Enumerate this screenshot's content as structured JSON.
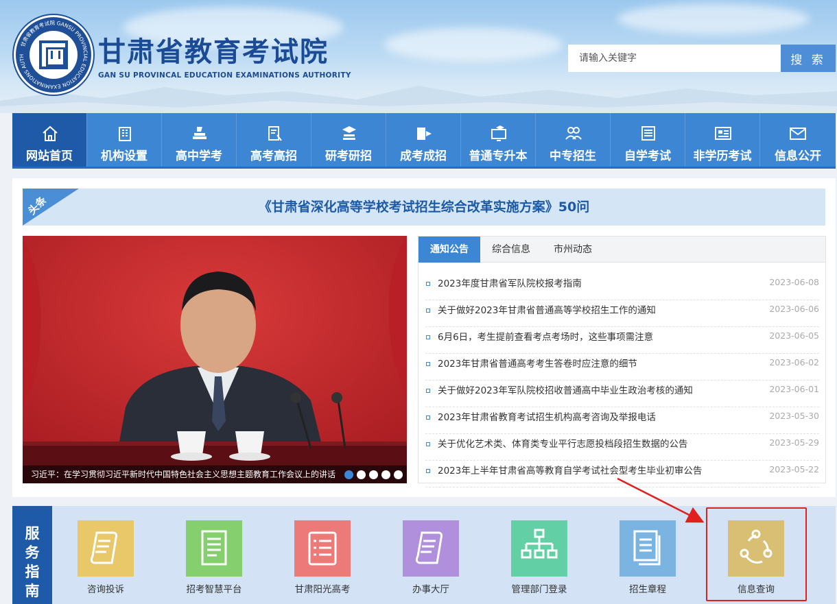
{
  "header": {
    "title": "甘肃省教育考试院",
    "subtitle": "GAN SU PROVINCAL EDUCATION EXAMINATIONS AUTHORITY",
    "seal_text": "甘肃省教育考试院 GANSU PROVINCIAL EDUCATION EXAMINATIONS AUTHORITY",
    "search_placeholder": "请输入关键字",
    "search_button": "搜 索"
  },
  "nav": [
    {
      "label": "网站首页",
      "icon": "home-icon",
      "active": true
    },
    {
      "label": "机构设置",
      "icon": "building-icon"
    },
    {
      "label": "高中学考",
      "icon": "books-icon"
    },
    {
      "label": "高考高招",
      "icon": "document-pen-icon"
    },
    {
      "label": "研考研招",
      "icon": "graduation-books-icon"
    },
    {
      "label": "成考成招",
      "icon": "book-flag-icon"
    },
    {
      "label": "普通专升本",
      "icon": "monitor-cap-icon"
    },
    {
      "label": "中专招生",
      "icon": "people-icon"
    },
    {
      "label": "自学考试",
      "icon": "list-icon"
    },
    {
      "label": "非学历考试",
      "icon": "id-card-icon"
    },
    {
      "label": "信息公开",
      "icon": "mail-icon"
    }
  ],
  "headline": {
    "tag": "头条",
    "title": "《甘肃省深化高等学校考试招生综合改革实施方案》50问"
  },
  "slideshow": {
    "caption": "习近平：在学习贯彻习近平新时代中国特色社会主义思想主题教育工作会议上的讲话",
    "total": 5,
    "current": 1
  },
  "news": {
    "tabs": [
      "通知公告",
      "综合信息",
      "市州动态"
    ],
    "active_tab": "通知公告",
    "items": [
      {
        "title": "2023年度甘肃省军队院校报考指南",
        "date": "2023-06-08"
      },
      {
        "title": "关于做好2023年甘肃省普通高等学校招生工作的通知",
        "date": "2023-06-06"
      },
      {
        "title": "6月6日，考生提前查看考点考场时，这些事项需注意",
        "date": "2023-06-05"
      },
      {
        "title": "2023年甘肃省普通高考考生答卷时应注意的细节",
        "date": "2023-06-02"
      },
      {
        "title": "关于做好2023年军队院校招收普通高中毕业生政治考核的通知",
        "date": "2023-06-01"
      },
      {
        "title": "2023年甘肃省教育考试招生机构高考咨询及举报电话",
        "date": "2023-05-30"
      },
      {
        "title": "关于优化艺术类、体育类专业平行志愿投档段招生数据的公告",
        "date": "2023-05-29"
      },
      {
        "title": "2023年上半年甘肃省高等教育自学考试社会型考生毕业初审公告",
        "date": "2023-05-22"
      }
    ]
  },
  "guide": {
    "label": "服务指南",
    "items": [
      {
        "name": "咨询投诉",
        "color": "#e9c86a",
        "icon": "note-icon"
      },
      {
        "name": "招考智慧平台",
        "color": "#86cf6e",
        "icon": "document-list-icon"
      },
      {
        "name": "甘肃阳光高考",
        "color": "#ec7a78",
        "icon": "list-panel-icon"
      },
      {
        "name": "办事大厅",
        "color": "#b090dd",
        "icon": "note-icon"
      },
      {
        "name": "管理部门登录",
        "color": "#62cfa5",
        "icon": "org-chart-icon"
      },
      {
        "name": "招生章程",
        "color": "#7bb4e1",
        "icon": "pages-icon"
      },
      {
        "name": "信息查询",
        "color": "#d9bf74",
        "icon": "share-nodes-icon"
      }
    ]
  },
  "colors": {
    "brand": "#1c4b95",
    "nav": "#3c86d4",
    "nav_active": "#1e5aa8",
    "highlight": "#e0201e"
  }
}
